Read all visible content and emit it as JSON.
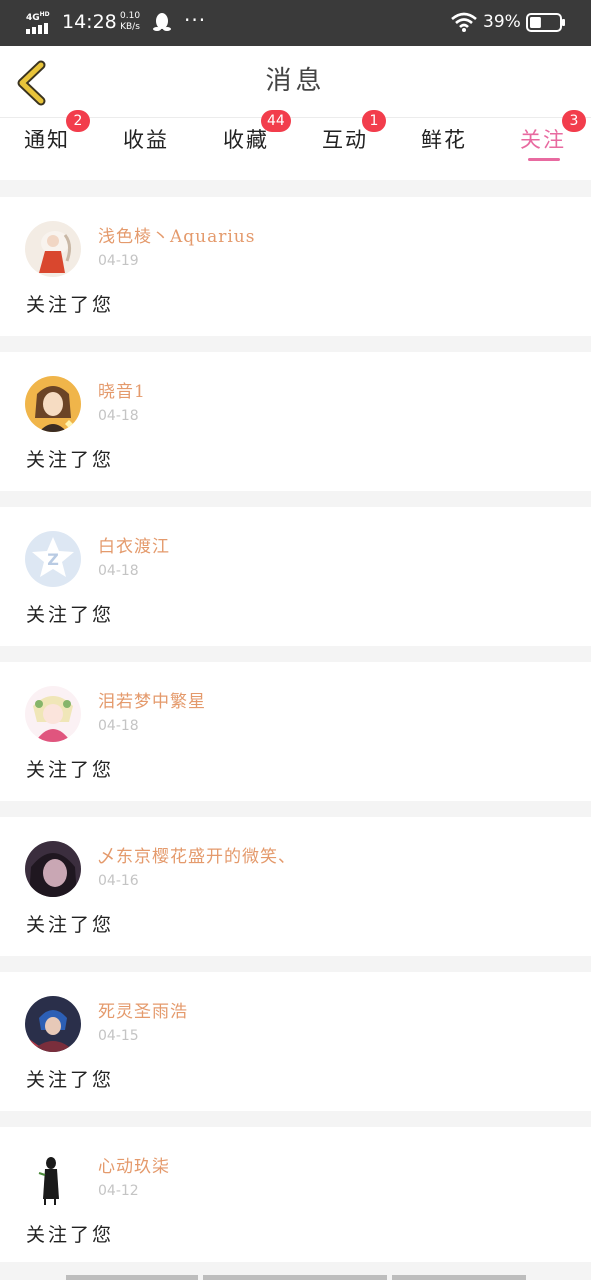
{
  "status_bar": {
    "network": "4G",
    "network_hd": "HD",
    "time": "14:28",
    "speed_value": "0.10",
    "speed_unit": "KB/s",
    "more": "···",
    "battery_percent": "39%",
    "battery_level": 0.39,
    "icons": [
      "signal-icon",
      "qq-penguin-icon",
      "wifi-icon",
      "battery-icon"
    ]
  },
  "header": {
    "title": "消息",
    "back_icon": "chevron-left-icon"
  },
  "tabs": [
    {
      "label": "通知",
      "badge": "2"
    },
    {
      "label": "收益",
      "badge": ""
    },
    {
      "label": "收藏",
      "badge": "44"
    },
    {
      "label": "互动",
      "badge": "1"
    },
    {
      "label": "鲜花",
      "badge": ""
    },
    {
      "label": "关注",
      "badge": "3",
      "active": true
    }
  ],
  "colors": {
    "accent": "#e86aa0",
    "badge": "#f23d4c",
    "username": "#e49a6c",
    "date": "#c4c4c4",
    "back_icon": "#e8c43a"
  },
  "messages": [
    {
      "user": "浅色棱丶Aquarius",
      "date": "04-19",
      "text": "关注了您"
    },
    {
      "user": "晓音1",
      "date": "04-18",
      "text": "关注了您"
    },
    {
      "user": "白衣渡江",
      "date": "04-18",
      "text": "关注了您"
    },
    {
      "user": "泪若梦中繁星",
      "date": "04-18",
      "text": "关注了您"
    },
    {
      "user": "乄东京樱花盛开的微笑、",
      "date": "04-16",
      "text": "关注了您"
    },
    {
      "user": "死灵圣雨浩",
      "date": "04-15",
      "text": "关注了您"
    },
    {
      "user": "心动玖柒",
      "date": "04-12",
      "text": "关注了您"
    }
  ]
}
